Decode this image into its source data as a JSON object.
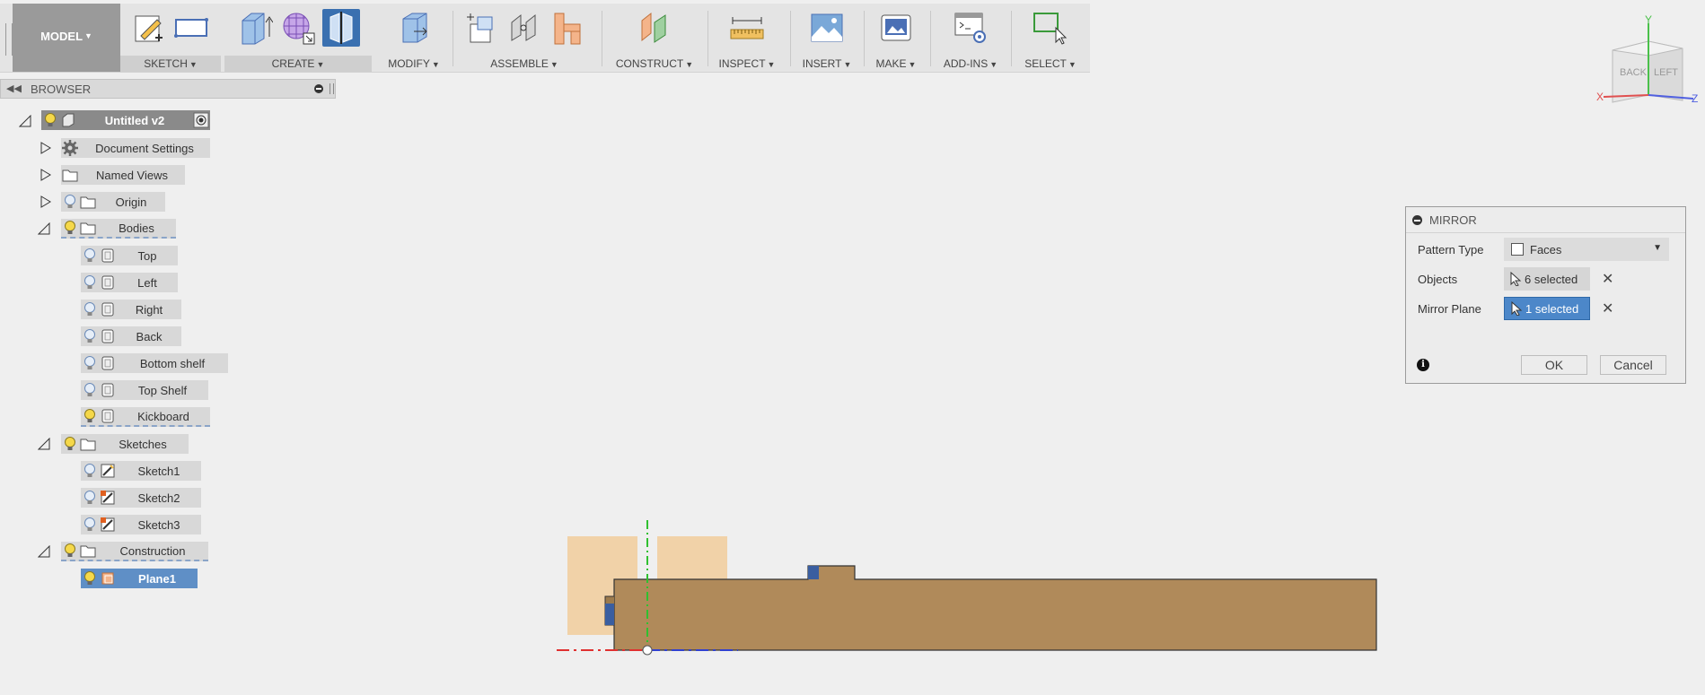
{
  "toolbar": {
    "model": "MODEL",
    "groups": {
      "sketch": "SKETCH",
      "create": "CREATE",
      "modify": "MODIFY",
      "assemble": "ASSEMBLE",
      "construct": "CONSTRUCT",
      "inspect": "INSPECT",
      "insert": "INSERT",
      "make": "MAKE",
      "addins": "ADD-INS",
      "select": "SELECT"
    },
    "active_tool": "mirror"
  },
  "browser": {
    "title": "BROWSER",
    "root": "Untitled v2",
    "document_settings": "Document Settings",
    "named_views": "Named Views",
    "origin": "Origin",
    "bodies": "Bodies",
    "body_items": [
      "Top",
      "Left",
      "Right",
      "Back",
      "Bottom shelf",
      "Top Shelf",
      "Kickboard"
    ],
    "sketches": "Sketches",
    "sketch_items": [
      "Sketch1",
      "Sketch2",
      "Sketch3"
    ],
    "construction": "Construction",
    "plane": "Plane1"
  },
  "mirror_dialog": {
    "title": "MIRROR",
    "pattern_type_label": "Pattern Type",
    "pattern_type_value": "Faces",
    "objects_label": "Objects",
    "objects_value": "6 selected",
    "mirror_plane_label": "Mirror Plane",
    "mirror_plane_value": "1 selected",
    "ok": "OK",
    "cancel": "Cancel"
  },
  "viewcube": {
    "back": "BACK",
    "left": "LEFT",
    "axis_x": "X",
    "axis_y": "Y",
    "axis_z": "Z"
  },
  "colors": {
    "accent": "#3a70b0",
    "selection": "#5f8fc6",
    "wood": "#b08a5a",
    "plane": "#f2c890",
    "axis_x": "#e03030",
    "axis_y": "#30c030",
    "axis_z": "#3040d0"
  }
}
